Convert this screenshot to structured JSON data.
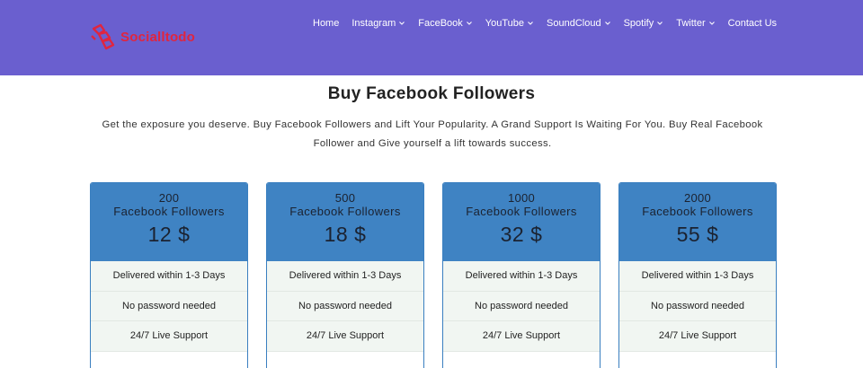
{
  "brand": {
    "name": "Socialltodo",
    "logo_color": "#e0253f"
  },
  "colors": {
    "header_bg": "#6a5fcf",
    "plan_head_bg": "#3f83c3",
    "feature_bg": "#f1f6f2"
  },
  "nav": {
    "items": [
      {
        "label": "Home",
        "has_dropdown": false
      },
      {
        "label": "Instagram",
        "has_dropdown": true
      },
      {
        "label": "FaceBook",
        "has_dropdown": true
      },
      {
        "label": "YouTube",
        "has_dropdown": true
      },
      {
        "label": "SoundCloud",
        "has_dropdown": true
      },
      {
        "label": "Spotify",
        "has_dropdown": true
      },
      {
        "label": "Twitter",
        "has_dropdown": true
      },
      {
        "label": "Contact Us",
        "has_dropdown": false
      }
    ]
  },
  "main": {
    "title": "Buy Facebook Followers",
    "intro": "Get the exposure you deserve. Buy Facebook Followers and Lift Your Popularity. A Grand Support Is Waiting For You. Buy Real Facebook Follower and Give yourself a lift towards success."
  },
  "plans": [
    {
      "quantity": "200",
      "unit": "Facebook Followers",
      "price": "12 $",
      "features": [
        "Delivered within 1-3 Days",
        "No password needed",
        "24/7 Live Support"
      ]
    },
    {
      "quantity": "500",
      "unit": "Facebook Followers",
      "price": "18 $",
      "features": [
        "Delivered within 1-3 Days",
        "No password needed",
        "24/7 Live Support"
      ]
    },
    {
      "quantity": "1000",
      "unit": "Facebook Followers",
      "price": "32 $",
      "features": [
        "Delivered within 1-3 Days",
        "No password needed",
        "24/7 Live Support"
      ]
    },
    {
      "quantity": "2000",
      "unit": "Facebook Followers",
      "price": "55 $",
      "features": [
        "Delivered within 1-3 Days",
        "No password needed",
        "24/7 Live Support"
      ]
    }
  ]
}
